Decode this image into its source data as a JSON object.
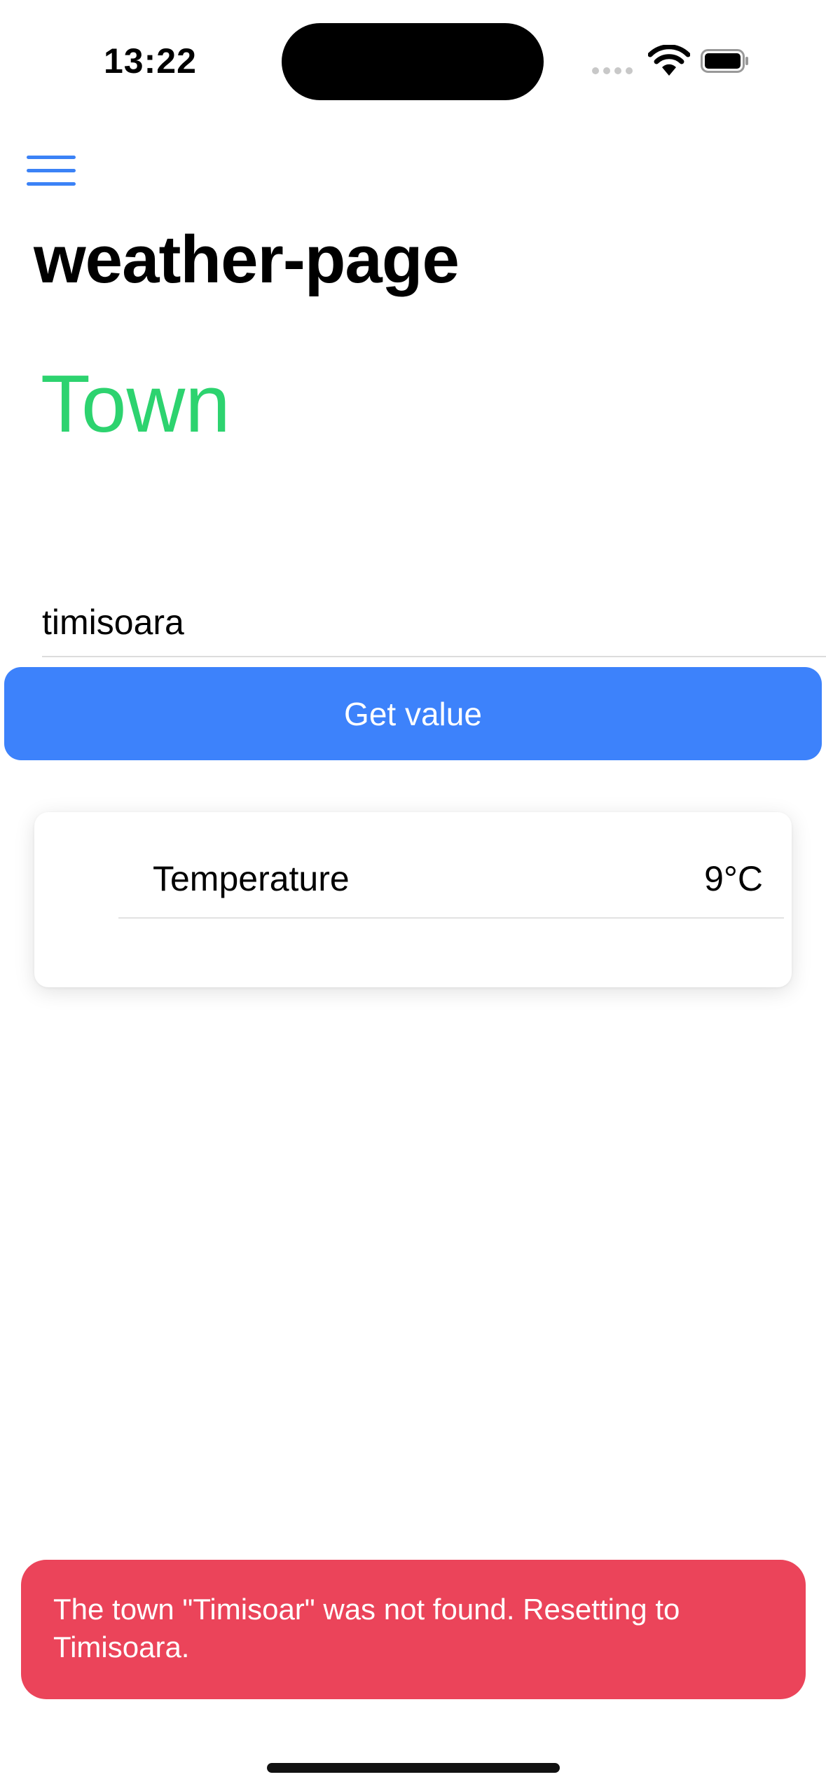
{
  "status_bar": {
    "time": "13:22",
    "icons": [
      "cellular-signal-icon",
      "wifi-icon",
      "battery-icon"
    ]
  },
  "header": {
    "menu_icon": "hamburger-menu-icon",
    "title": "weather-page"
  },
  "main": {
    "town_heading": "Town",
    "town_input_value": "timisoara",
    "get_button_label": "Get value"
  },
  "weather_card": {
    "temperature_label": "Temperature",
    "temperature_value": "9°C"
  },
  "toast": {
    "message": "The town \"Timisoar\" was not found. Resetting to Timisoara."
  },
  "colors": {
    "accent": "#3d82fb",
    "town_heading": "#2dd36f",
    "toast_background": "#eb445a"
  }
}
